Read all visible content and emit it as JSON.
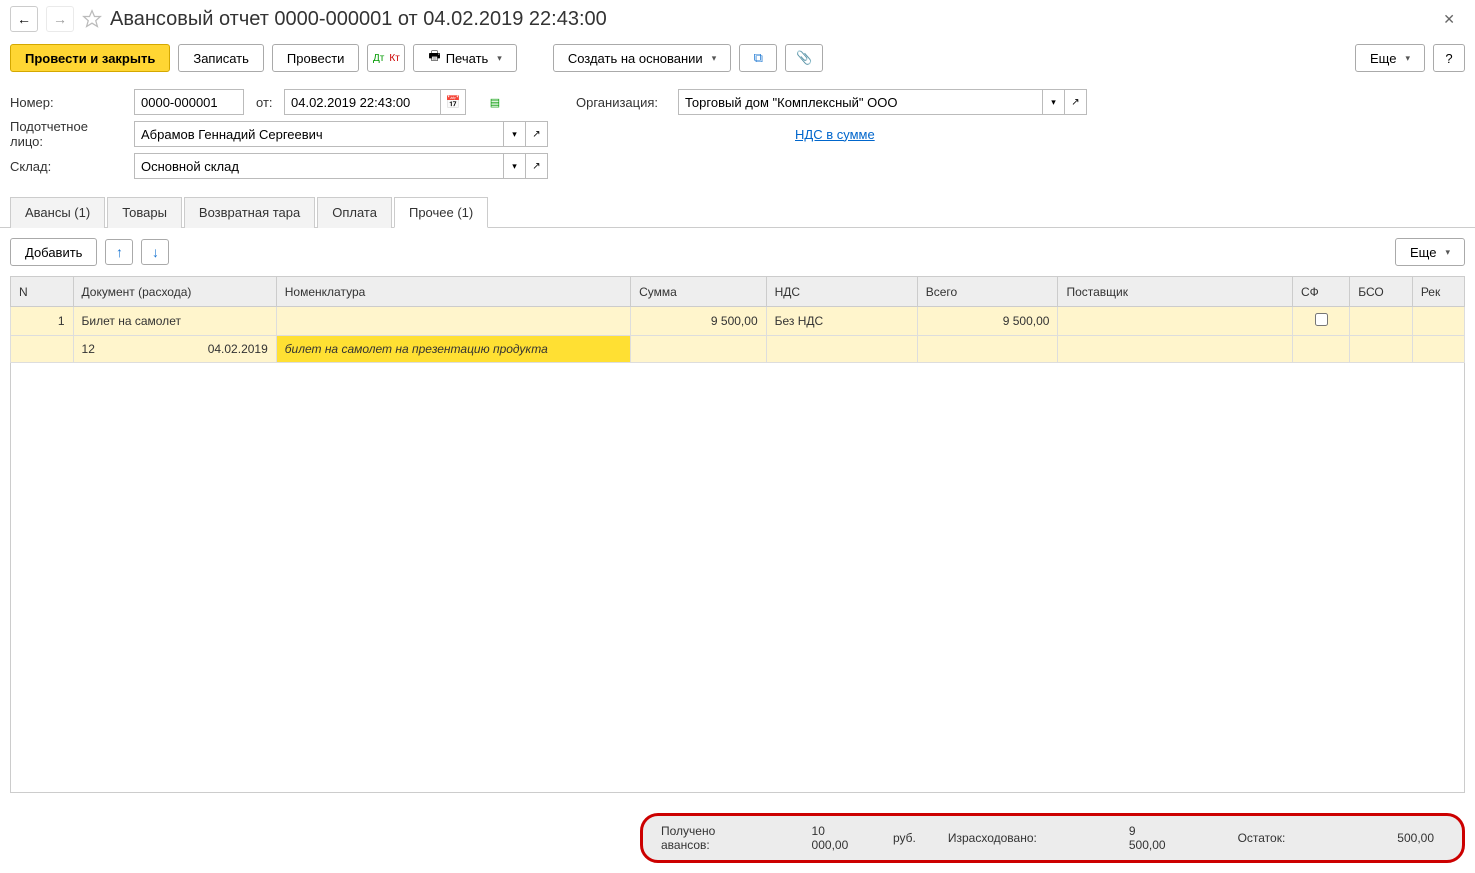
{
  "title": "Авансовый отчет 0000-000001 от 04.02.2019 22:43:00",
  "toolbar": {
    "post_close": "Провести и закрыть",
    "save": "Записать",
    "post": "Провести",
    "print": "Печать",
    "create_based": "Создать на основании",
    "more": "Еще",
    "help": "?"
  },
  "form": {
    "number_label": "Номер:",
    "number_value": "0000-000001",
    "from_label": "от:",
    "date_value": "04.02.2019 22:43:00",
    "org_label": "Организация:",
    "org_value": "Торговый дом \"Комплексный\" ООО",
    "person_label": "Подотчетное лицо:",
    "person_value": "Абрамов Геннадий Сергеевич",
    "vat_link": "НДС в сумме",
    "sklad_label": "Склад:",
    "sklad_value": "Основной склад"
  },
  "tabs": {
    "advances": "Авансы (1)",
    "goods": "Товары",
    "tara": "Возвратная тара",
    "payment": "Оплата",
    "other": "Прочее (1)"
  },
  "tab_toolbar": {
    "add": "Добавить",
    "more": "Еще"
  },
  "grid": {
    "cols": {
      "n": "N",
      "doc": "Документ (расхода)",
      "nomen": "Номенклатура",
      "sum": "Сумма",
      "vat": "НДС",
      "total": "Всего",
      "supplier": "Поставщик",
      "sf": "СФ",
      "bso": "БСО",
      "rek": "Рек"
    },
    "row1": {
      "n": "1",
      "doc": "Билет на самолет",
      "sum": "9 500,00",
      "vat": "Без НДС",
      "total": "9 500,00"
    },
    "row2": {
      "qty": "12",
      "date": "04.02.2019",
      "desc": "билет на самолет на презентацию продукта"
    }
  },
  "footer": {
    "received_label": "Получено авансов:",
    "received_value": "10 000,00",
    "currency": "руб.",
    "spent_label": "Израсходовано:",
    "spent_value": "9 500,00",
    "balance_label": "Остаток:",
    "balance_value": "500,00"
  }
}
